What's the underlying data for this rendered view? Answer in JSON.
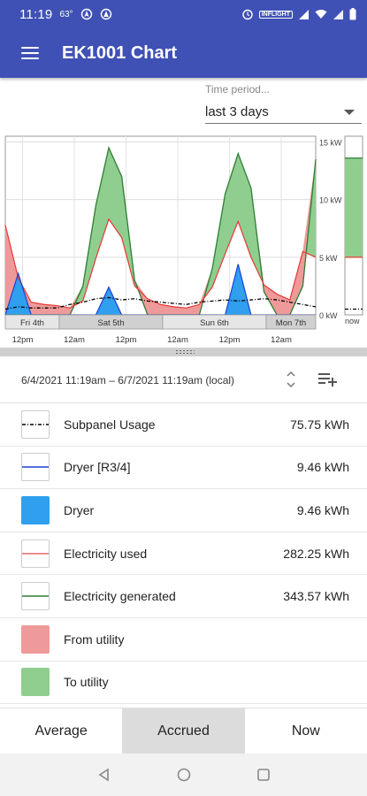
{
  "status_bar": {
    "time": "11:19",
    "temperature": "63°",
    "badge": "INFLIGHT"
  },
  "app_bar": {
    "title": "EK1001 Chart",
    "menu_icon": "hamburger-menu-icon"
  },
  "time_period": {
    "label": "Time period...",
    "value": "last 3 days"
  },
  "range": {
    "text": "6/4/2021 11:19am – 6/7/2021 11:19am (local)"
  },
  "legend": [
    {
      "label": "Subpanel Usage",
      "value": "75.75 kWh",
      "style": "dashdot",
      "color": "#000000"
    },
    {
      "label": "Dryer [R3/4]",
      "value": "9.46 kWh",
      "style": "line",
      "color": "#1f3fd6"
    },
    {
      "label": "Dryer",
      "value": "9.46 kWh",
      "style": "fill",
      "color": "#2f9fee"
    },
    {
      "label": "Electricity used",
      "value": "282.25 kWh",
      "style": "line",
      "color": "#e26d6d"
    },
    {
      "label": "Electricity generated",
      "value": "343.57 kWh",
      "style": "line",
      "color": "#2e7d32"
    },
    {
      "label": "From utility",
      "value": "",
      "style": "fill",
      "color": "#ef9a9a"
    },
    {
      "label": "To utility",
      "value": "",
      "style": "fill",
      "color": "#8fce8f"
    }
  ],
  "tabs": [
    {
      "label": "Average",
      "active": false
    },
    {
      "label": "Accrued",
      "active": true
    },
    {
      "label": "Now",
      "active": false
    }
  ],
  "chart_data": {
    "type": "area",
    "y_unit": "kW",
    "y_ticks": [
      "0 kW",
      "5 kW",
      "10 kW",
      "15 kW"
    ],
    "ylim": [
      0,
      15.5
    ],
    "x_ticks": [
      "12pm",
      "12am",
      "12pm",
      "12am",
      "12pm",
      "12am"
    ],
    "day_labels": [
      "Fri 4th",
      "Sat 5th",
      "Sun 6th",
      "Mon 7th"
    ],
    "now_label": "now",
    "x_hours": [
      0,
      3,
      6,
      9,
      12,
      15,
      18,
      21,
      24,
      27,
      30,
      33,
      36,
      39,
      42,
      45,
      48,
      51,
      54,
      57,
      60,
      63,
      66,
      69,
      72
    ],
    "series": [
      {
        "name": "Electricity generated",
        "color": "#2e7d32",
        "values": [
          0.0,
          0.0,
          0.0,
          0.0,
          0.0,
          0.0,
          2.5,
          9.5,
          14.5,
          12.0,
          3.0,
          0.0,
          0.0,
          0.0,
          0.0,
          0.0,
          4.0,
          10.5,
          14.0,
          11.0,
          2.0,
          0.0,
          0.0,
          2.5,
          13.5
        ]
      },
      {
        "name": "Electricity used",
        "color": "#e26d6d",
        "values": [
          7.8,
          3.2,
          1.1,
          0.9,
          0.8,
          0.6,
          1.2,
          4.9,
          8.3,
          6.7,
          2.5,
          1.4,
          0.9,
          0.7,
          0.6,
          0.9,
          2.4,
          5.3,
          8.1,
          5.0,
          2.6,
          1.8,
          1.3,
          5.5,
          5.0
        ]
      },
      {
        "name": "Subpanel Usage",
        "color": "#000000",
        "values": [
          0.5,
          0.7,
          0.6,
          0.6,
          0.6,
          0.9,
          1.1,
          1.4,
          1.5,
          1.3,
          1.4,
          1.2,
          1.1,
          1.0,
          0.9,
          1.1,
          1.2,
          1.3,
          1.2,
          1.3,
          1.4,
          1.3,
          1.1,
          0.9,
          0.7
        ]
      },
      {
        "name": "Dryer",
        "color": "#2f9fee",
        "values": [
          0,
          3.6,
          0,
          0,
          0,
          0,
          0,
          0,
          2.4,
          0,
          0,
          0,
          0,
          0,
          0,
          0,
          0,
          0,
          4.4,
          0,
          0,
          0,
          0,
          0,
          0
        ]
      }
    ],
    "now_bar": {
      "total": 15.0,
      "generated_to": 13.6,
      "used": 5.0,
      "subpanel": 0.5
    }
  }
}
